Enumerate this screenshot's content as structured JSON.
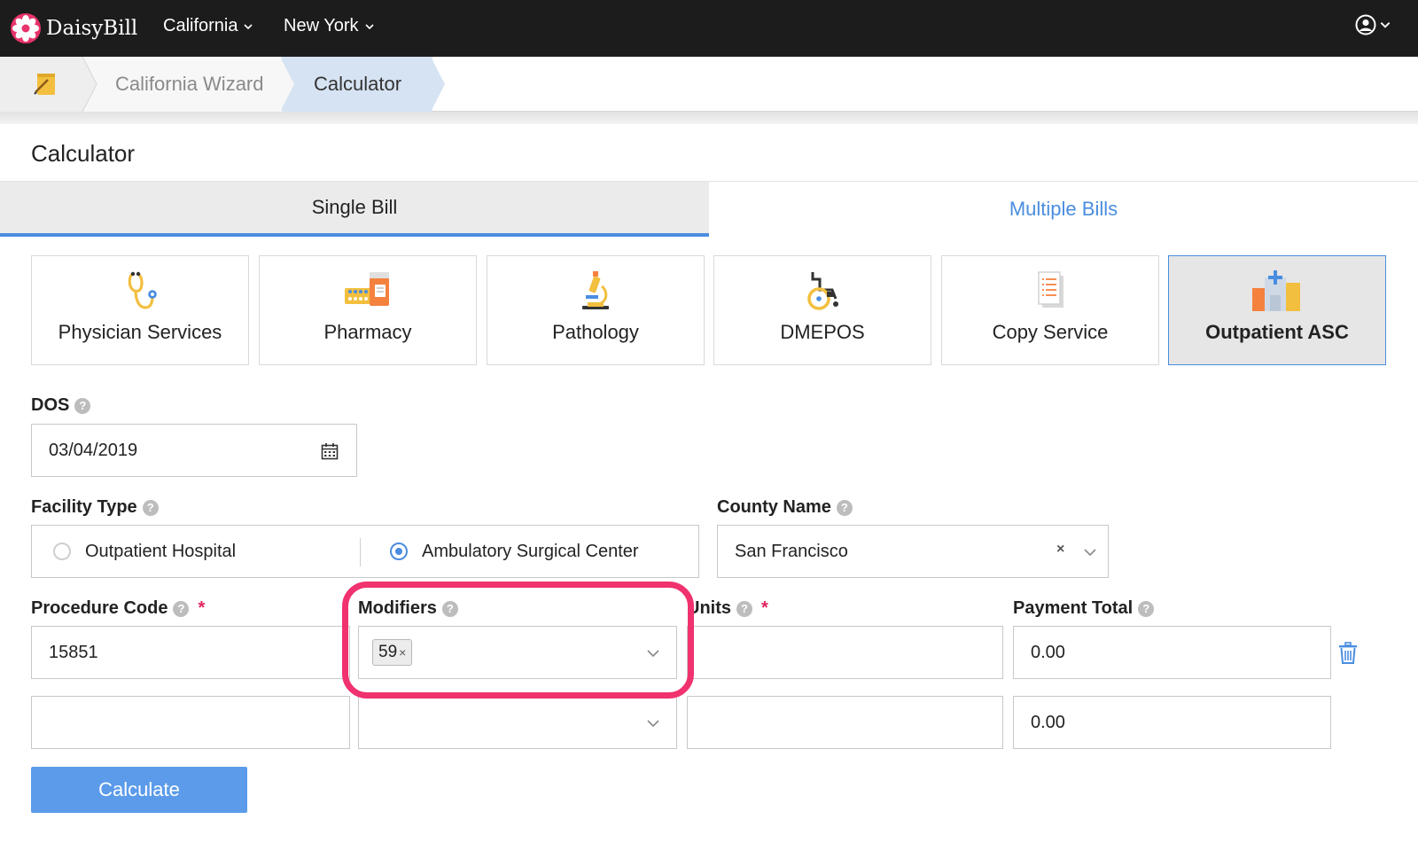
{
  "app": {
    "name": "DaisyBill"
  },
  "nav": {
    "items": [
      {
        "label": "California"
      },
      {
        "label": "New York"
      }
    ]
  },
  "breadcrumb": {
    "items": [
      {
        "label": "California Wizard"
      },
      {
        "label": "Calculator"
      }
    ]
  },
  "page": {
    "title": "Calculator"
  },
  "tabs": [
    {
      "label": "Single Bill",
      "active": true
    },
    {
      "label": "Multiple Bills",
      "active": false
    }
  ],
  "services": [
    {
      "label": "Physician Services",
      "icon": "stethoscope-icon"
    },
    {
      "label": "Pharmacy",
      "icon": "pharmacy-icon"
    },
    {
      "label": "Pathology",
      "icon": "microscope-icon"
    },
    {
      "label": "DMEPOS",
      "icon": "wheelchair-icon"
    },
    {
      "label": "Copy Service",
      "icon": "document-copy-icon"
    },
    {
      "label": "Outpatient ASC",
      "icon": "hospital-icon",
      "active": true
    }
  ],
  "form": {
    "dos": {
      "label": "DOS",
      "value": "03/04/2019"
    },
    "facility_type": {
      "label": "Facility Type",
      "options": [
        {
          "label": "Outpatient Hospital",
          "selected": false
        },
        {
          "label": "Ambulatory Surgical Center",
          "selected": true
        }
      ]
    },
    "county": {
      "label": "County Name",
      "value": "San Francisco"
    },
    "columns": {
      "procedure_code": "Procedure Code",
      "modifiers": "Modifiers",
      "units": "Units",
      "payment_total": "Payment Total",
      "required_mark": "*"
    },
    "rows": [
      {
        "procedure_code": "15851",
        "modifiers": [
          "59"
        ],
        "units": "",
        "payment_total": "0.00"
      },
      {
        "procedure_code": "",
        "modifiers": [],
        "units": "",
        "payment_total": "0.00"
      }
    ],
    "calculate_label": "Calculate"
  },
  "help_glyph": "?",
  "tag_remove_glyph": "×",
  "clear_glyph": "×",
  "colors": {
    "accent": "#4a8de0",
    "button": "#5b9bea",
    "highlight": "#f0326f",
    "topbar": "#1c1c1c",
    "breadcrumb_active": "#d6e3f2"
  }
}
